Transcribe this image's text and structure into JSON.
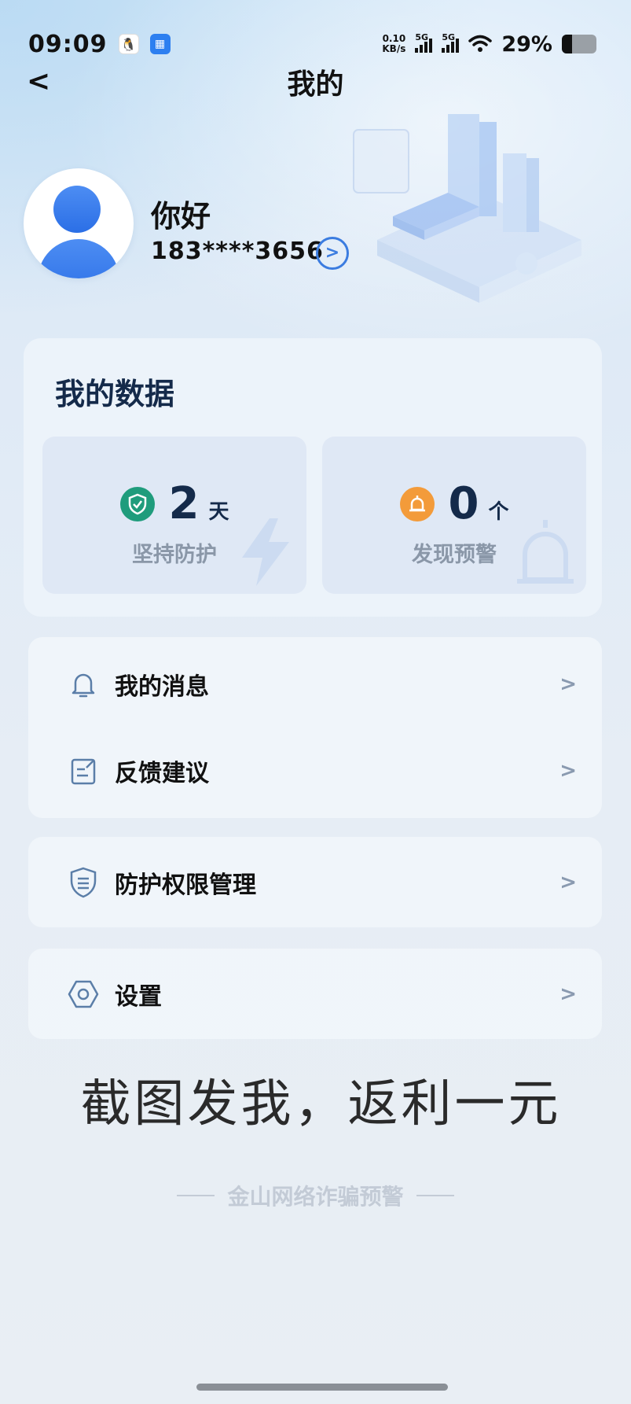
{
  "status_bar": {
    "time": "09:09",
    "qq_icon": "qq-penguin-icon",
    "app_icon": "blue-app-icon",
    "net_speed_value": "0.10",
    "net_speed_unit": "KB/s",
    "sim1_label": "5G",
    "sim2_label": "5G",
    "battery_percent": "29%",
    "battery_level": 0.29
  },
  "header": {
    "title": "我的",
    "back_label": "<"
  },
  "profile": {
    "greeting": "你好",
    "phone": "183****3656",
    "arrow": ">"
  },
  "my_data": {
    "title": "我的数据",
    "protection": {
      "value": "2",
      "unit": "天",
      "label": "坚持防护",
      "icon": "shield-check-icon",
      "color": "#1f9c7c"
    },
    "warnings": {
      "value": "0",
      "unit": "个",
      "label": "发现预警",
      "icon": "alarm-light-icon",
      "color": "#f39b3a"
    }
  },
  "menu": {
    "messages": {
      "label": "我的消息",
      "icon": "bell-icon",
      "chevron": ">"
    },
    "feedback": {
      "label": "反馈建议",
      "icon": "edit-note-icon",
      "chevron": ">"
    },
    "permissions": {
      "label": "防护权限管理",
      "icon": "shield-settings-icon",
      "chevron": ">"
    },
    "settings": {
      "label": "设置",
      "icon": "hexagon-settings-icon",
      "chevron": ">"
    }
  },
  "promo_text": "截图发我，返利一元",
  "footer_text": "金山网络诈骗预警",
  "colors": {
    "accent": "#2b6fe6",
    "title_text": "#142a4a",
    "chevron": "#8a9ab0"
  }
}
